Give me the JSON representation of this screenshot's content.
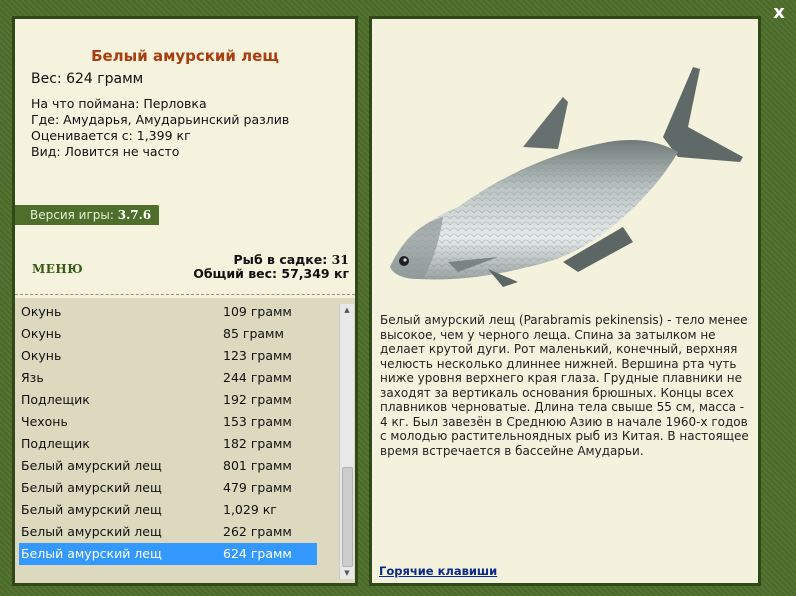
{
  "window": {
    "close_label": "x"
  },
  "fish": {
    "title": "Белый амурский лещ",
    "weight": "Вес: 624 грамм",
    "details": [
      "На что поймана: Перловка",
      "Где: Амударья, Амударьинский разлив",
      "Оценивается с: 1,399 кг",
      "Вид: Ловится не часто"
    ]
  },
  "version": {
    "label": "Версия игры:",
    "value": "3.7.6"
  },
  "menu_label": "МЕНЮ",
  "stats": {
    "count_label": "Рыб в садке:",
    "count_value": "31",
    "total_label": "Общий вес:",
    "total_value": "57,349 кг"
  },
  "catch_list": [
    {
      "name": "Окунь",
      "weight": "109 грамм"
    },
    {
      "name": "Окунь",
      "weight": "85 грамм"
    },
    {
      "name": "Окунь",
      "weight": "123 грамм"
    },
    {
      "name": "Язь",
      "weight": "244 грамм"
    },
    {
      "name": "Подлещик",
      "weight": "192 грамм"
    },
    {
      "name": "Чехонь",
      "weight": "153 грамм"
    },
    {
      "name": "Подлещик",
      "weight": "182 грамм"
    },
    {
      "name": "Белый амурский лещ",
      "weight": "801 грамм"
    },
    {
      "name": "Белый амурский лещ",
      "weight": "479 грамм"
    },
    {
      "name": "Белый амурский лещ",
      "weight": "1,029 кг"
    },
    {
      "name": "Белый амурский лещ",
      "weight": "262 грамм"
    },
    {
      "name": "Белый амурский лещ",
      "weight": "624 грамм"
    }
  ],
  "selected_index": 11,
  "description": "Белый амурский лещ (Parabramis pekinensis) - тело менее высокое, чем у черного леща. Спина за затылком не делает крутой дуги. Рот маленький, конечный, верхняя челюсть несколько длиннее нижней. Вершина рта чуть ниже уровня верхнего края глаза. Грудные плавники не заходят за вертикаль основания брюшных. Концы всех плавников черноватые. Длина тела свыше 55 см, масса - 4 кг. Был завезён в Среднюю Азию в начале 1960-х годов с молодью растительноядных рыб из Китая. В настоящее время встречается в бассейне Амударьи.",
  "hotkeys_label": "Горячие клавиши",
  "icons": {
    "close": "close-icon",
    "fish": "fish-picture",
    "scroll_up": "arrow-up-icon",
    "scroll_down": "arrow-down-icon"
  },
  "colors": {
    "frame": "#4e6e2b",
    "panel": "#f5f2de",
    "title": "#a83e0e",
    "selection": "#3399ff",
    "list_bg": "#dcd9be"
  }
}
